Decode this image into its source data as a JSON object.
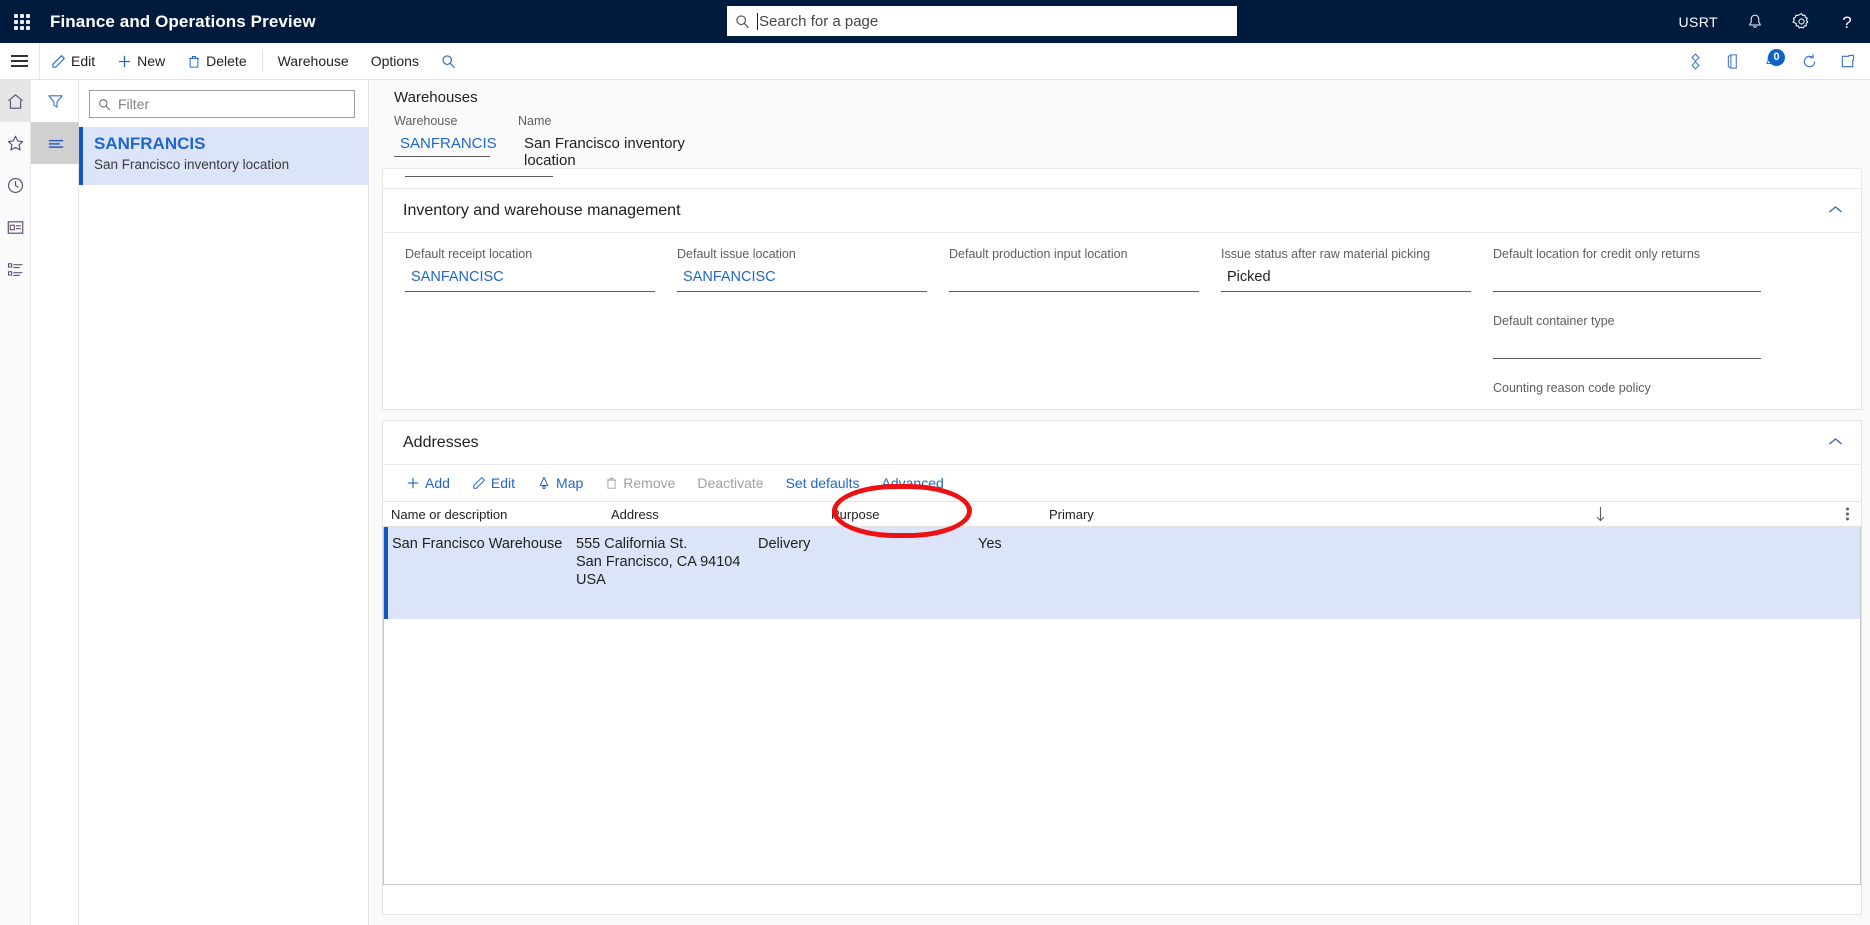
{
  "topbar": {
    "app_title": "Finance and Operations Preview",
    "waffle_icon": "app-launcher-icon",
    "search": {
      "placeholder": "Search for a page",
      "icon": "search-icon"
    },
    "user_initials": "USRT",
    "notifications_icon": "bell-icon",
    "settings_icon": "gear-icon",
    "help_icon": "question-mark-icon",
    "background_color": "#001b3d"
  },
  "commandbar": {
    "menu_icon": "hamburger-icon",
    "buttons": [
      {
        "label": "Edit",
        "icon": "pencil-icon"
      },
      {
        "label": "New",
        "icon": "plus-icon"
      },
      {
        "label": "Delete",
        "icon": "trash-icon"
      },
      {
        "label": "Warehouse",
        "icon": ""
      },
      {
        "label": "Options",
        "icon": ""
      }
    ],
    "search_icon": "search-icon",
    "right_icons": [
      {
        "name": "attachments-icon"
      },
      {
        "name": "open-in-office-icon"
      },
      {
        "name": "notifications-icon",
        "badge": "0"
      },
      {
        "name": "refresh-icon"
      },
      {
        "name": "open-new-window-icon"
      }
    ],
    "badge_color": "#0f63c8"
  },
  "left_rail": {
    "items": [
      {
        "name": "home-icon",
        "label": "Home",
        "active": true
      },
      {
        "name": "favorites-star-icon",
        "label": "Favorites",
        "active": false
      },
      {
        "name": "recent-clock-icon",
        "label": "Recent",
        "active": false
      },
      {
        "name": "workspaces-icon",
        "label": "Workspaces",
        "active": false
      },
      {
        "name": "modules-list-icon",
        "label": "Modules",
        "active": false
      }
    ]
  },
  "second_rail": {
    "items": [
      {
        "name": "filter-funnel-icon",
        "label": "Filter",
        "active": false
      },
      {
        "name": "list-lines-icon",
        "label": "List",
        "active": true
      }
    ]
  },
  "list_pane": {
    "filter": {
      "placeholder": "Filter",
      "icon": "search-icon",
      "value": ""
    },
    "records": [
      {
        "title": "SANFRANCIS",
        "subtitle": "San Francisco inventory location",
        "selected": true
      }
    ],
    "selected_bg": "#dbe4f8",
    "selected_bar": "#1158c7"
  },
  "page": {
    "title": "Warehouses",
    "header_fields": [
      {
        "label": "Warehouse",
        "value": "SANFRANCIS",
        "is_link": true
      },
      {
        "label": "Name",
        "value": "San Francisco inventory location",
        "is_link": false
      }
    ]
  },
  "sections": [
    {
      "title": "Inventory and warehouse management",
      "collapse_icon": "chevron-up-icon",
      "columns": [
        [
          {
            "label": "Default receipt location",
            "value": "SANFANCISC",
            "is_link": true
          }
        ],
        [
          {
            "label": "Default issue location",
            "value": "SANFANCISC",
            "is_link": true
          }
        ],
        [
          {
            "label": "Default production input location",
            "value": "",
            "is_link": false
          }
        ],
        [
          {
            "label": "Issue status after raw material picking",
            "value": "Picked",
            "is_link": false
          }
        ],
        [
          {
            "label": "Default location for credit only returns",
            "value": "",
            "is_link": false
          },
          {
            "label": "Default container type",
            "value": "",
            "is_link": false
          },
          {
            "label": "Counting reason code policy",
            "value": "",
            "is_link": false
          }
        ]
      ]
    }
  ],
  "addresses": {
    "title": "Addresses",
    "collapse_icon": "chevron-up-icon",
    "toolbar": [
      {
        "label": "Add",
        "icon": "plus-icon",
        "disabled": false
      },
      {
        "label": "Edit",
        "icon": "pencil-icon",
        "disabled": false
      },
      {
        "label": "Map",
        "icon": "map-pin-icon",
        "disabled": false
      },
      {
        "label": "Remove",
        "icon": "trash-icon",
        "disabled": true
      },
      {
        "label": "Deactivate",
        "icon": "",
        "disabled": true
      },
      {
        "label": "Set defaults",
        "icon": "",
        "disabled": false
      },
      {
        "label": "Advanced",
        "icon": "",
        "disabled": false
      }
    ],
    "columns": [
      {
        "label": "Name or description"
      },
      {
        "label": "Address"
      },
      {
        "label": "Purpose"
      },
      {
        "label": "Primary"
      }
    ],
    "sort_icon": "sort-descending-arrow-icon",
    "overflow_icon": "vertical-ellipsis-icon",
    "rows": [
      {
        "name": "San Francisco Warehouse",
        "address_lines": [
          "555 California St.",
          "San Francisco, CA 94104",
          "USA"
        ],
        "purpose": "Delivery",
        "primary": "Yes",
        "selected": true
      }
    ]
  },
  "annotation": {
    "target": "Advanced",
    "shape": "red-ellipse-highlight",
    "color": "#ee1111"
  }
}
